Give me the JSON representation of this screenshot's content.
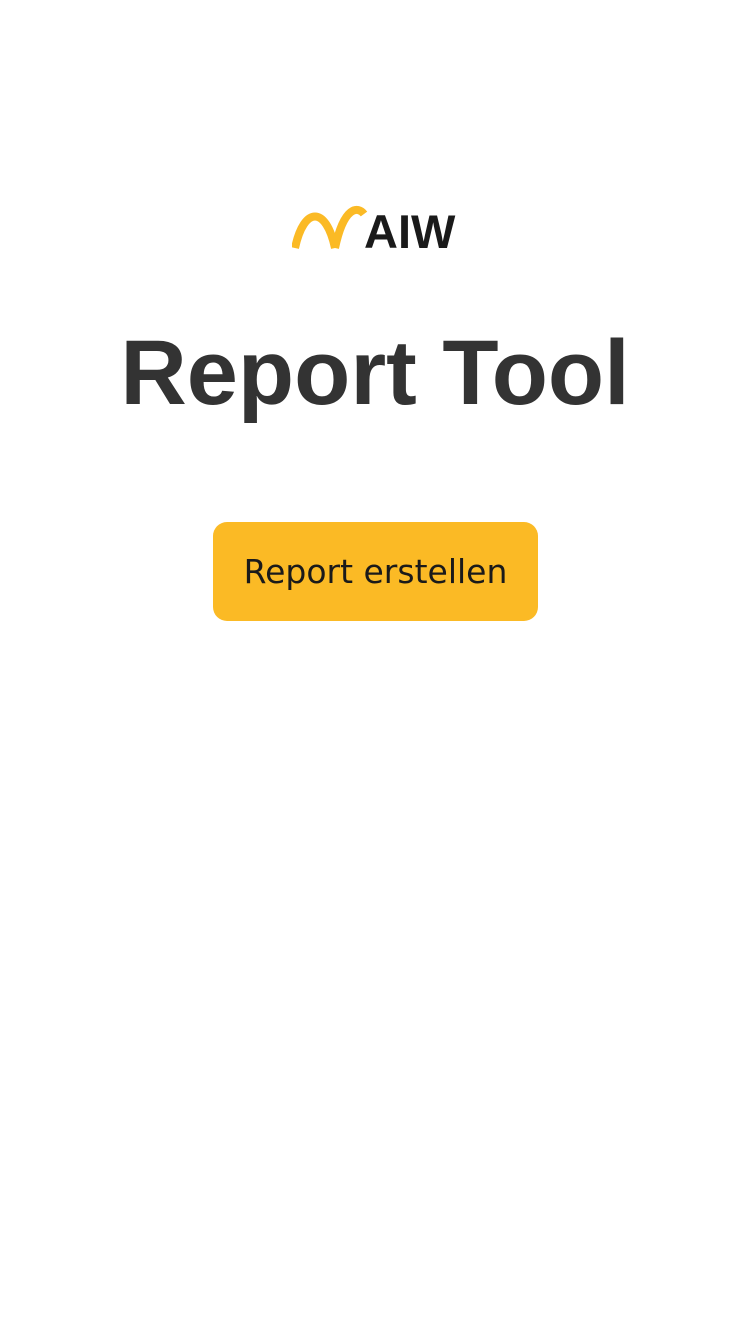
{
  "logo": {
    "text": "AIW",
    "icon": "arch-wave-logo-icon"
  },
  "page": {
    "title": "Report Tool"
  },
  "actions": {
    "create_report_label": "Report erstellen"
  },
  "colors": {
    "accent": "#FBBA25",
    "title_text": "#333333",
    "logo_text": "#1a1a1a",
    "background": "#ffffff"
  }
}
